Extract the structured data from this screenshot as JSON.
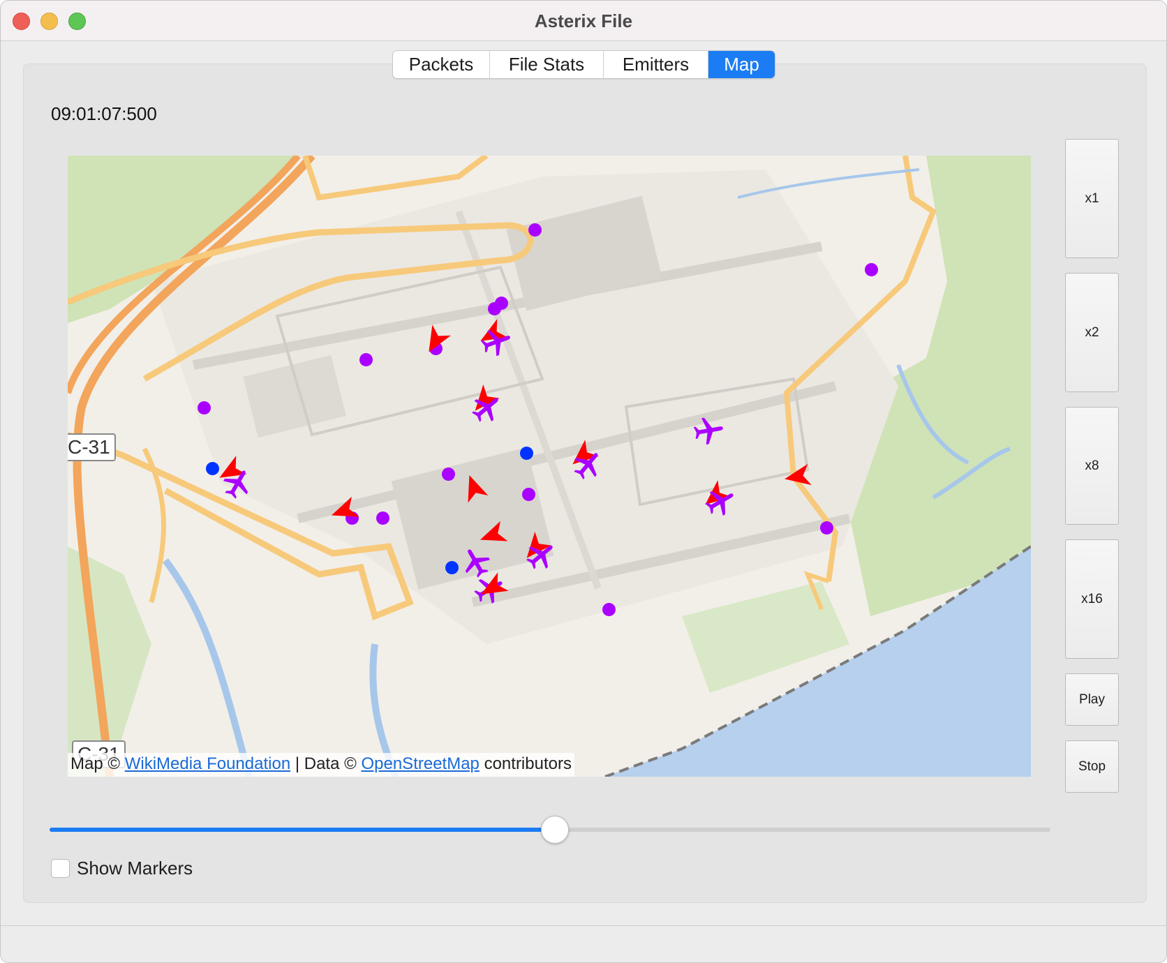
{
  "window": {
    "title": "Asterix File",
    "controls": [
      "close",
      "minimize",
      "maximize"
    ]
  },
  "tabs": [
    {
      "label": "Packets",
      "active": false
    },
    {
      "label": "File Stats",
      "active": false
    },
    {
      "label": "Emitters",
      "active": false
    },
    {
      "label": "Map",
      "active": true
    }
  ],
  "timestamp": "09:01:07:500",
  "map": {
    "road_labels": [
      "C-31",
      "C-31"
    ],
    "attribution": {
      "prefix": "Map © ",
      "source_link": "WikiMedia Foundation",
      "separator": " | Data © ",
      "data_link": "OpenStreetMap",
      "suffix": " contributors"
    },
    "marker_colors": {
      "purple": "#aa00ff",
      "blue": "#0033ff",
      "red": "#ff0000"
    },
    "icons": {
      "plane": "airplane-icon",
      "arrow": "direction-arrow-icon",
      "dot": "position-dot-icon"
    }
  },
  "playback_buttons": [
    {
      "label": "x1"
    },
    {
      "label": "x2"
    },
    {
      "label": "x8"
    },
    {
      "label": "x16"
    },
    {
      "label": "Play"
    },
    {
      "label": "Stop"
    }
  ],
  "slider": {
    "value_fraction": 0.505
  },
  "show_markers": {
    "label": "Show Markers",
    "checked": false
  },
  "colors": {
    "accent": "#1b7cf4",
    "water": "#b6d0ee",
    "park": "#cfe3b7",
    "road": "#f7c97a",
    "highway": "#f2a55b"
  }
}
